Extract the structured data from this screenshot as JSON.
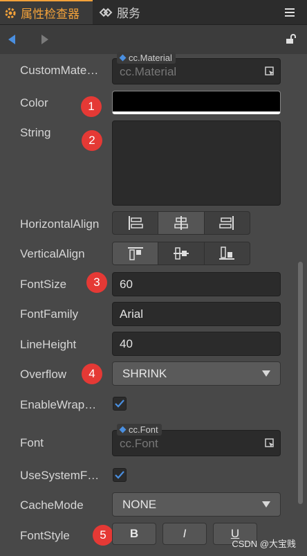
{
  "tabs": {
    "inspector": "属性检查器",
    "services": "服务"
  },
  "props": {
    "custom_material": {
      "label": "CustomMate…",
      "tag": "cc.Material",
      "placeholder": "cc.Material"
    },
    "color": {
      "label": "Color",
      "value": "#000000"
    },
    "string": {
      "label": "String",
      "value": ""
    },
    "horizontal_align": {
      "label": "HorizontalAlign",
      "selected": "center"
    },
    "vertical_align": {
      "label": "VerticalAlign",
      "selected": "top"
    },
    "font_size": {
      "label": "FontSize",
      "value": "60"
    },
    "font_family": {
      "label": "FontFamily",
      "value": "Arial"
    },
    "line_height": {
      "label": "LineHeight",
      "value": "40"
    },
    "overflow": {
      "label": "Overflow",
      "value": "SHRINK"
    },
    "enable_wrap": {
      "label": "EnableWrap…",
      "checked": true
    },
    "font": {
      "label": "Font",
      "tag": "cc.Font",
      "placeholder": "cc.Font"
    },
    "use_system_font": {
      "label": "UseSystemF…",
      "checked": true
    },
    "cache_mode": {
      "label": "CacheMode",
      "value": "NONE"
    },
    "font_style": {
      "label": "FontStyle",
      "bold": "B",
      "italic": "I",
      "underline": "U"
    }
  },
  "badges": [
    "1",
    "2",
    "3",
    "4",
    "5"
  ],
  "watermark": "CSDN @大宝贱",
  "colors": {
    "accent": "#f3a23a",
    "badge": "#e53935",
    "link": "#4a8fe0"
  }
}
